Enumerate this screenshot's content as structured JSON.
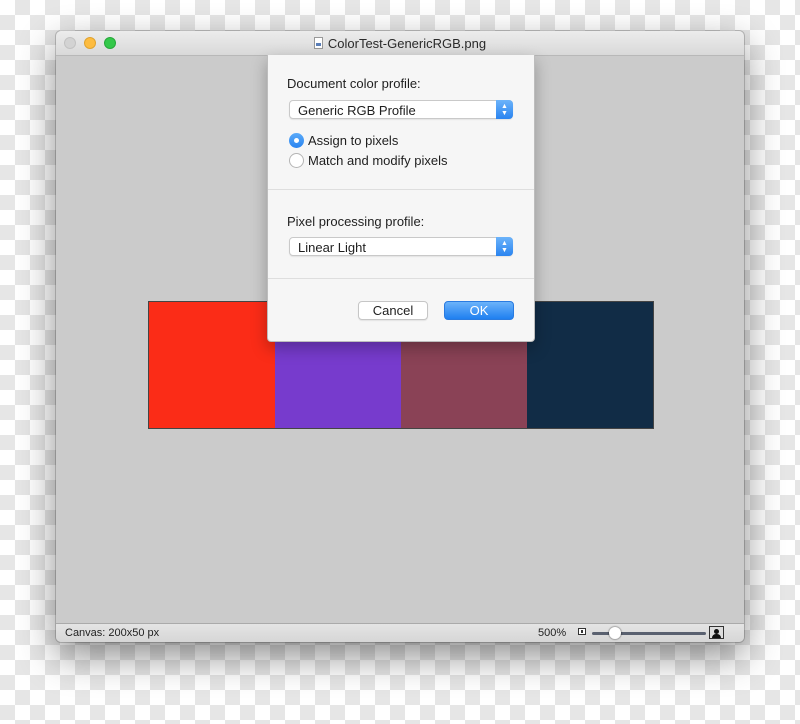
{
  "window": {
    "title": "ColorTest-GenericRGB.png",
    "file_icon": "document-icon"
  },
  "canvas": {
    "swatches": [
      {
        "name": "red",
        "color": "#fb2c17"
      },
      {
        "name": "purple",
        "color": "#773bcd"
      },
      {
        "name": "mauve",
        "color": "#8a4256"
      },
      {
        "name": "navy",
        "color": "#112c46"
      }
    ]
  },
  "statusbar": {
    "canvas_info": "Canvas: 200x50 px",
    "zoom_level": "500%",
    "zoom_slider_fraction": 0.2
  },
  "dialog": {
    "document_profile_label": "Document color profile:",
    "document_profile_value": "Generic RGB Profile",
    "radio_options": [
      {
        "label": "Assign to pixels",
        "selected": true
      },
      {
        "label": "Match and modify pixels",
        "selected": false
      }
    ],
    "pixel_profile_label": "Pixel processing profile:",
    "pixel_profile_value": "Linear Light",
    "cancel_label": "Cancel",
    "ok_label": "OK"
  },
  "colors": {
    "accent": "#2a84f0"
  }
}
